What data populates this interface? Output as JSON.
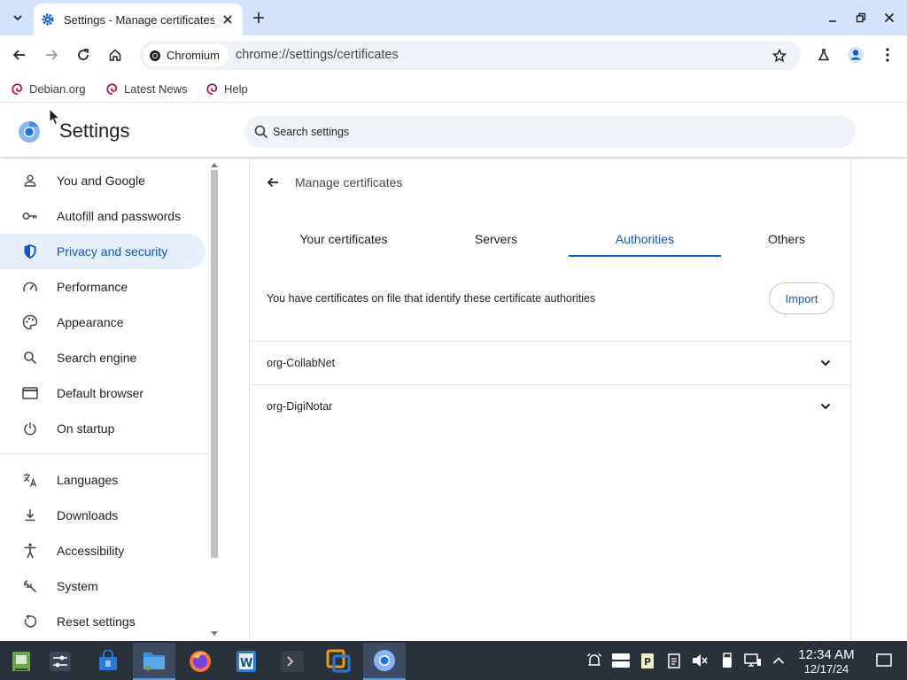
{
  "browser": {
    "tab_title": "Settings - Manage certificates",
    "omnibox_chip": "Chromium",
    "url": "chrome://settings/certificates",
    "bookmarks": [
      "Debian.org",
      "Latest News",
      "Help"
    ]
  },
  "settings": {
    "title": "Settings",
    "search_placeholder": "Search settings",
    "nav": [
      {
        "label": "You and Google",
        "icon": "person-icon"
      },
      {
        "label": "Autofill and passwords",
        "icon": "key-icon"
      },
      {
        "label": "Privacy and security",
        "icon": "shield-icon",
        "active": true
      },
      {
        "label": "Performance",
        "icon": "speedometer-icon"
      },
      {
        "label": "Appearance",
        "icon": "palette-icon"
      },
      {
        "label": "Search engine",
        "icon": "search-icon"
      },
      {
        "label": "Default browser",
        "icon": "browser-window-icon"
      },
      {
        "label": "On startup",
        "icon": "power-icon"
      }
    ],
    "nav_advanced": [
      {
        "label": "Languages",
        "icon": "translate-icon"
      },
      {
        "label": "Downloads",
        "icon": "download-icon"
      },
      {
        "label": "Accessibility",
        "icon": "accessibility-icon"
      },
      {
        "label": "System",
        "icon": "wrench-icon"
      },
      {
        "label": "Reset settings",
        "icon": "reset-icon"
      }
    ]
  },
  "certificates": {
    "page_title": "Manage certificates",
    "tabs": [
      "Your certificates",
      "Servers",
      "Authorities",
      "Others"
    ],
    "active_tab": "Authorities",
    "description": "You have certificates on file that identify these certificate authorities",
    "import_label": "Import",
    "authorities": [
      "org-CollabNet",
      "org-DigiNotar"
    ]
  },
  "taskbar": {
    "time": "12:34 AM",
    "date": "12/17/24"
  },
  "colors": {
    "accent": "#0b57d0",
    "tabstrip": "#d3e3fd",
    "active_nav": "#e7effd",
    "taskbar": "#29313b"
  }
}
